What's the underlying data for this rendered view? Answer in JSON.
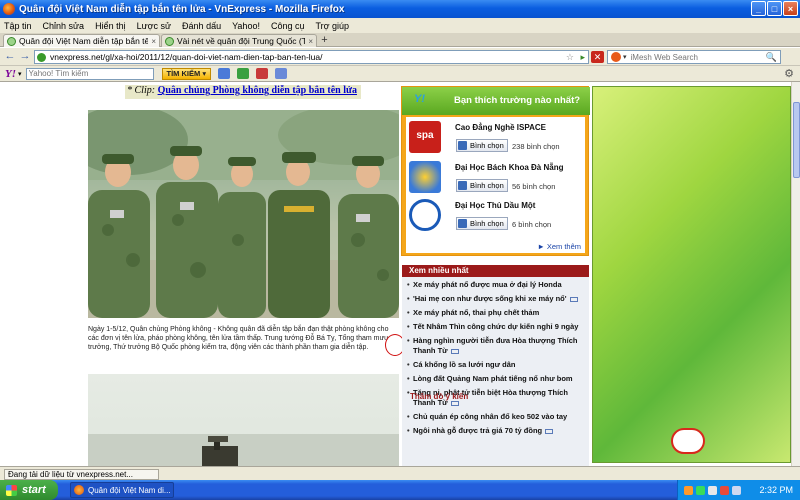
{
  "window": {
    "title": "Quân đội Việt Nam diễn tập bắn tên lửa - VnExpress - Mozilla Firefox",
    "controls": {
      "minimize": "_",
      "maximize": "□",
      "close": "×"
    }
  },
  "menu": [
    "Tập tin",
    "Chỉnh sửa",
    "Hiển thị",
    "Lược sử",
    "Đánh dấu",
    "Yahoo!",
    "Công cụ",
    "Trợ giúp"
  ],
  "tabs": [
    {
      "label": "Quân đội Việt Nam diễn tập bắn tên lửa - ...",
      "close": "×"
    },
    {
      "label": "Vài nét về quân đội Trung Quốc (Tài liệu t...",
      "close": "×"
    }
  ],
  "new_tab": "+",
  "nav": {
    "back": "←",
    "forward": "→",
    "url": "vnexpress.net/gl/xa-hoi/2011/12/quan-doi-viet-nam-dien-tap-ban-ten-lua/",
    "star": "☆",
    "go": "▸",
    "stop": "✕",
    "search_placeholder": "iMesh Web Search",
    "search_dropdown": "▾",
    "search_button": "🔍"
  },
  "yahoo_toolbar": {
    "logo": "Y!",
    "logo_dropdown": "▾",
    "search_placeholder": "Yahoo! Tìm kiếm",
    "search_button": "TÌM KIẾM ▾",
    "settings": "⚙"
  },
  "article": {
    "caption_prefix": "* Clip:",
    "caption_link": "Quân chủng Phòng không diễn tập bắn tên lửa",
    "photo_text": "Ngày 1-5/12, Quân chủng Phòng không - Không quân đã diễn tập bắn đạn thật phòng không cho các đơn vị tên lửa, pháo phòng không, tên lửa tầm thấp. Trung tướng Đỗ Bá Tỵ, Tổng tham mưu trưởng, Thứ trưởng Bộ Quốc phòng kiểm tra, động viên các thành phần tham gia diễn tập."
  },
  "promo": {
    "logo": "Y!",
    "title": "Bạn thích trường nào nhất?",
    "vote_label": "Bình chọn",
    "items": [
      {
        "name": "Cao Đẳng Nghề ISPACE",
        "votes": "238 bình chọn",
        "thumb_color": "#c8201a",
        "thumb_text": "spa"
      },
      {
        "name": "Đại Học Bách Khoa Đà Nẵng",
        "votes": "56 bình chọn",
        "thumb_color": "#3a7ad8",
        "thumb_text": ""
      },
      {
        "name": "Đại Học Thủ Dầu Một",
        "votes": "6 bình chọn",
        "thumb_color": "#1a5ab8",
        "thumb_text": ""
      }
    ],
    "more": "► Xem thêm"
  },
  "most_read": {
    "header": "Xem nhiều nhất",
    "items": [
      {
        "text": "Xe máy phát nổ được mua ở đại lý Honda",
        "video": false
      },
      {
        "text": "'Hai mẹ con như được sống khi xe máy nổ'",
        "video": true
      },
      {
        "text": "Xe máy phát nổ, thai phụ chết thảm",
        "video": false
      },
      {
        "text": "Tết Nhâm Thìn công chức dự kiến nghỉ 9 ngày",
        "video": false
      },
      {
        "text": "Hàng nghìn người tiễn đưa Hòa thượng Thích Thanh Từ",
        "video": true
      },
      {
        "text": "Cá khổng lồ sa lưới ngư dân",
        "video": false
      },
      {
        "text": "Lòng đất Quảng Nam phát tiếng nổ như bom",
        "video": false
      },
      {
        "text": "Tăng ni, phật tử tiễn biệt Hòa thượng Thích Thanh Từ",
        "video": true
      },
      {
        "text": "Chủ quán ép công nhân đổ keo 502 vào tay",
        "video": false
      },
      {
        "text": "Ngôi nhà gỗ được trả giá 70 tỷ đồng",
        "video": true
      }
    ]
  },
  "poll_label": "Thăm dò ý kiến",
  "status": "Đang tải dữ liệu từ vnexpress.net...",
  "taskbar": {
    "start": "start",
    "item": "Quân đội Việt Nam di...",
    "time": "2:32 PM"
  }
}
